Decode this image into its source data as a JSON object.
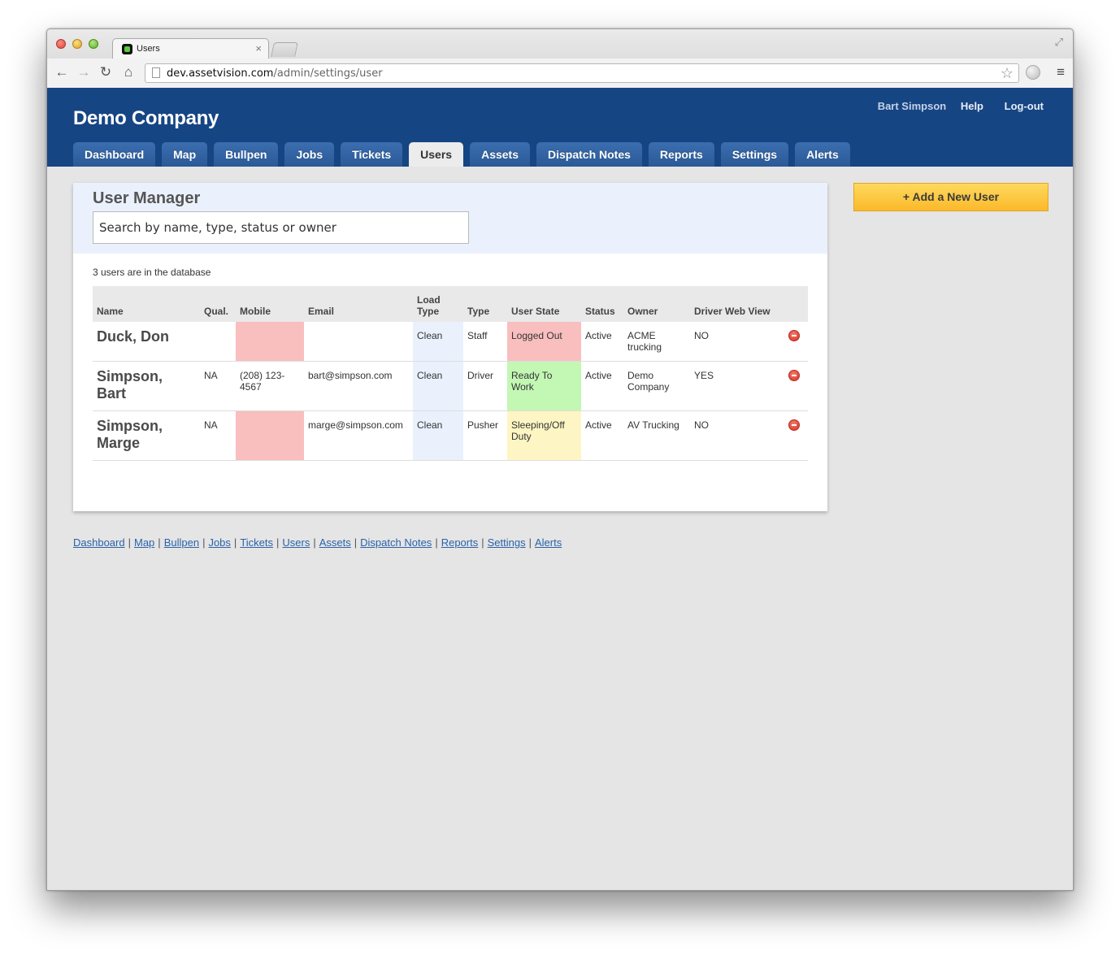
{
  "browser": {
    "tab_title": "Users",
    "url_host": "dev.assetvision.com",
    "url_path": "/admin/settings/user"
  },
  "header": {
    "company": "Demo Company",
    "user_name": "Bart Simpson",
    "help": "Help",
    "logout": "Log-out"
  },
  "nav_tabs": [
    {
      "label": "Dashboard"
    },
    {
      "label": "Map"
    },
    {
      "label": "Bullpen"
    },
    {
      "label": "Jobs"
    },
    {
      "label": "Tickets"
    },
    {
      "label": "Users",
      "active": true
    },
    {
      "label": "Assets"
    },
    {
      "label": "Dispatch Notes"
    },
    {
      "label": "Reports"
    },
    {
      "label": "Settings"
    },
    {
      "label": "Alerts"
    }
  ],
  "panel": {
    "title": "User Manager",
    "search_placeholder": "Search by name, type, status or owner",
    "count_text": "3 users are in the database"
  },
  "add_user_button": "+ Add a New User",
  "table": {
    "headers": [
      "Name",
      "Qual.",
      "Mobile",
      "Email",
      "Load Type",
      "Type",
      "User State",
      "Status",
      "Owner",
      "Driver Web View"
    ],
    "rows": [
      {
        "name": "Duck, Don",
        "qual": "",
        "mobile": "",
        "email": "",
        "load_type": "Clean",
        "type": "Staff",
        "user_state": "Logged Out",
        "status": "Active",
        "owner": "ACME trucking",
        "driver_web_view": "NO"
      },
      {
        "name": "Simpson, Bart",
        "qual": "NA",
        "mobile": "(208) 123-4567",
        "email": "bart@simpson.com",
        "load_type": "Clean",
        "type": "Driver",
        "user_state": "Ready To Work",
        "status": "Active",
        "owner": "Demo Company",
        "driver_web_view": "YES"
      },
      {
        "name": "Simpson, Marge",
        "qual": "NA",
        "mobile": "",
        "email": "marge@simpson.com",
        "load_type": "Clean",
        "type": "Pusher",
        "user_state": "Sleeping/Off Duty",
        "status": "Active",
        "owner": "AV Trucking",
        "driver_web_view": "NO"
      }
    ]
  },
  "footer_links": [
    "Dashboard",
    "Map",
    "Bullpen",
    "Jobs",
    "Tickets",
    "Users",
    "Assets",
    "Dispatch Notes",
    "Reports",
    "Settings",
    "Alerts"
  ],
  "colors": {
    "header_blue": "#164584",
    "tab_blue": "#2a5996",
    "missing_pink": "#f9bebe",
    "ready_green": "#c3f7b4",
    "sleeping_yellow": "#fdf6c4",
    "add_button": "#fbb92b"
  }
}
